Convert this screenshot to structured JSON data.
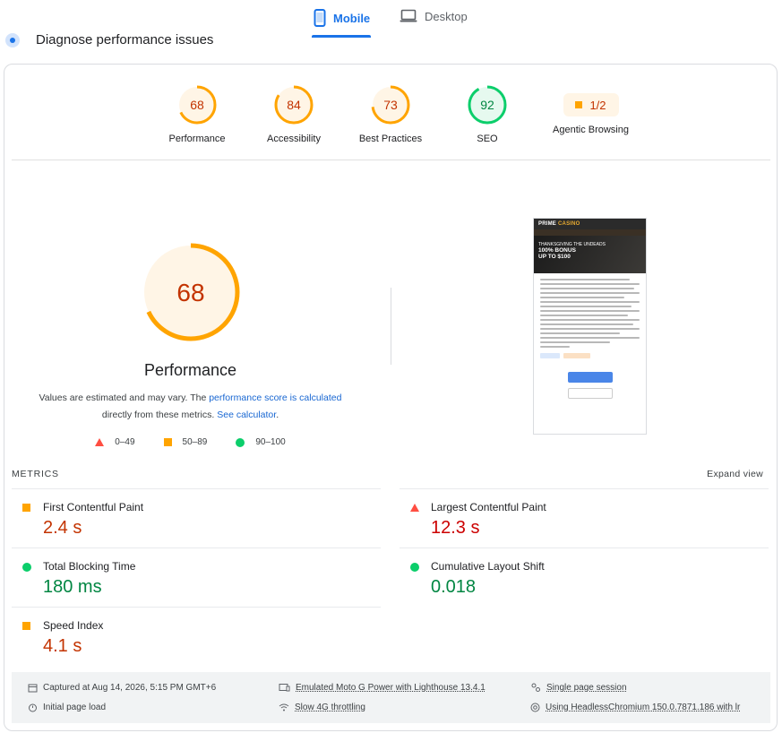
{
  "tabs": {
    "mobile": "Mobile",
    "desktop": "Desktop"
  },
  "section_title": "Diagnose performance issues",
  "categories": [
    {
      "label": "Performance",
      "score": "68",
      "color": "#ffa400",
      "fraction": 0.68
    },
    {
      "label": "Accessibility",
      "score": "84",
      "color": "#ffa400",
      "fraction": 0.84
    },
    {
      "label": "Best Practices",
      "score": "73",
      "color": "#ffa400",
      "fraction": 0.73
    },
    {
      "label": "SEO",
      "score": "92",
      "color": "#0cce6b",
      "fraction": 0.92
    },
    {
      "label": "Agentic Browsing",
      "score": "1/2"
    }
  ],
  "main": {
    "score": "68",
    "score_fraction": 0.68,
    "label": "Performance",
    "desc_1": "Values are estimated and may vary. The ",
    "desc_link_1": "performance score is calculated",
    "desc_2": " directly from these metrics. ",
    "desc_link_2": "See calculator",
    "desc_3": "."
  },
  "legend": {
    "fail": "0–49",
    "average": "50–89",
    "pass": "90–100"
  },
  "thumbnail": {
    "brand": "PRIME",
    "brand_suffix": "CASINO",
    "banner_small": "THANKSGIVING THE UNDEADS",
    "banner_big_1": "100% BONUS",
    "banner_big_2": "UP TO $100"
  },
  "metrics_title": "METRICS",
  "expand_view": "Expand view",
  "metrics": {
    "fcp": {
      "name": "First Contentful Paint",
      "value": "2.4 s"
    },
    "lcp": {
      "name": "Largest Contentful Paint",
      "value": "12.3 s"
    },
    "tbt": {
      "name": "Total Blocking Time",
      "value": "180 ms"
    },
    "cls": {
      "name": "Cumulative Layout Shift",
      "value": "0.018"
    },
    "si": {
      "name": "Speed Index",
      "value": "4.1 s"
    }
  },
  "footer": {
    "captured": "Captured at Aug 14, 2026, 5:15 PM GMT+6",
    "initial_load": "Initial page load",
    "emulated": "Emulated Moto G Power with Lighthouse 13.4.1",
    "throttling": "Slow 4G throttling",
    "session": "Single page session",
    "browser": "Using HeadlessChromium 150.0.7871.186 with lr"
  }
}
